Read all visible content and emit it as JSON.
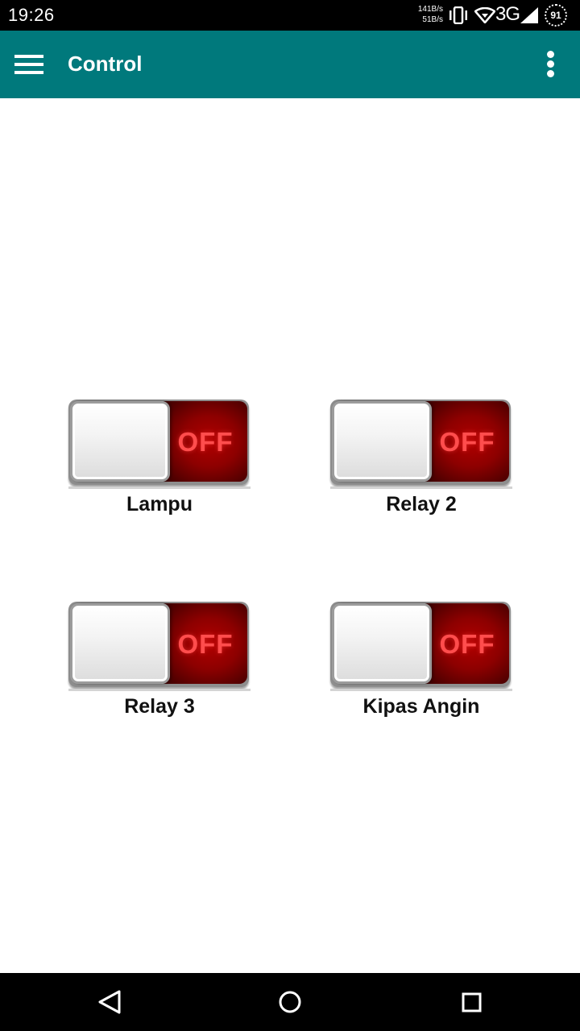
{
  "status_bar": {
    "time": "19:26",
    "speed_up": "141B/s",
    "speed_down": "51B/s",
    "network": "3G",
    "battery": "91",
    "icons": [
      "vibrate-icon",
      "wifi-icon",
      "signal-icon",
      "battery-icon"
    ]
  },
  "app_bar": {
    "title": "Control",
    "background_color": "#00797c",
    "menu_icon": "hamburger-menu-icon",
    "overflow_icon": "more-vert-icon"
  },
  "switches": [
    {
      "label": "Lampu",
      "state": "OFF"
    },
    {
      "label": "Relay 2",
      "state": "OFF"
    },
    {
      "label": "Relay 3",
      "state": "OFF"
    },
    {
      "label": "Kipas Angin",
      "state": "OFF"
    }
  ],
  "nav_bar": {
    "icons": [
      "back-icon",
      "home-icon",
      "recents-icon"
    ]
  }
}
